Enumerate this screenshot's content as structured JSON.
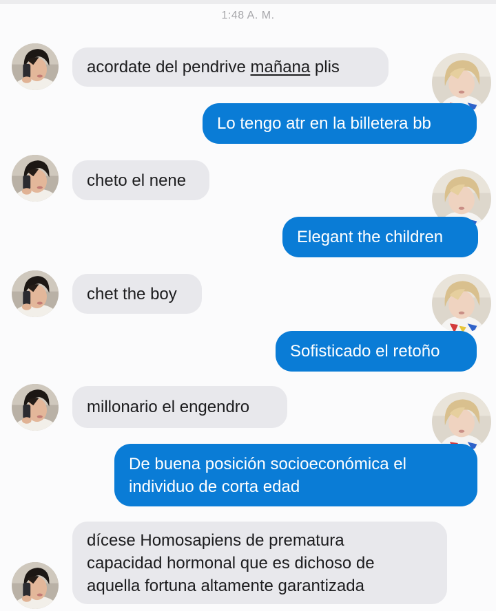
{
  "status": {
    "time": "1:48 A. M."
  },
  "contacts": {
    "left": {
      "avatar_icon": "selfie-avatar-dark-hair"
    },
    "right": {
      "avatar_icon": "selfie-avatar-blond-hair"
    }
  },
  "messages": [
    {
      "side": "left",
      "before": "acordate del pendrive ",
      "underlined": "mañana",
      "after": " plis"
    },
    {
      "side": "right",
      "text": "Lo tengo atr en la billetera bb"
    },
    {
      "side": "left",
      "text": "cheto el nene"
    },
    {
      "side": "right",
      "text": "Elegant the children"
    },
    {
      "side": "left",
      "text": "chet the boy"
    },
    {
      "side": "right",
      "text": "Sofisticado el retoño"
    },
    {
      "side": "left",
      "text": "millonario el engendro"
    },
    {
      "side": "right",
      "lines": [
        "De buena posición socioeconómica el",
        "individuo de corta edad"
      ]
    },
    {
      "side": "left",
      "lines": [
        "dícese Homosapiens de prematura",
        "capacidad hormonal que es dichoso de",
        "aquella fortuna altamente garantizada"
      ]
    }
  ],
  "colors": {
    "incoming_bubble": "#e8e8ec",
    "outgoing_bubble": "#0a7cd6",
    "background": "#fbfbfc"
  }
}
